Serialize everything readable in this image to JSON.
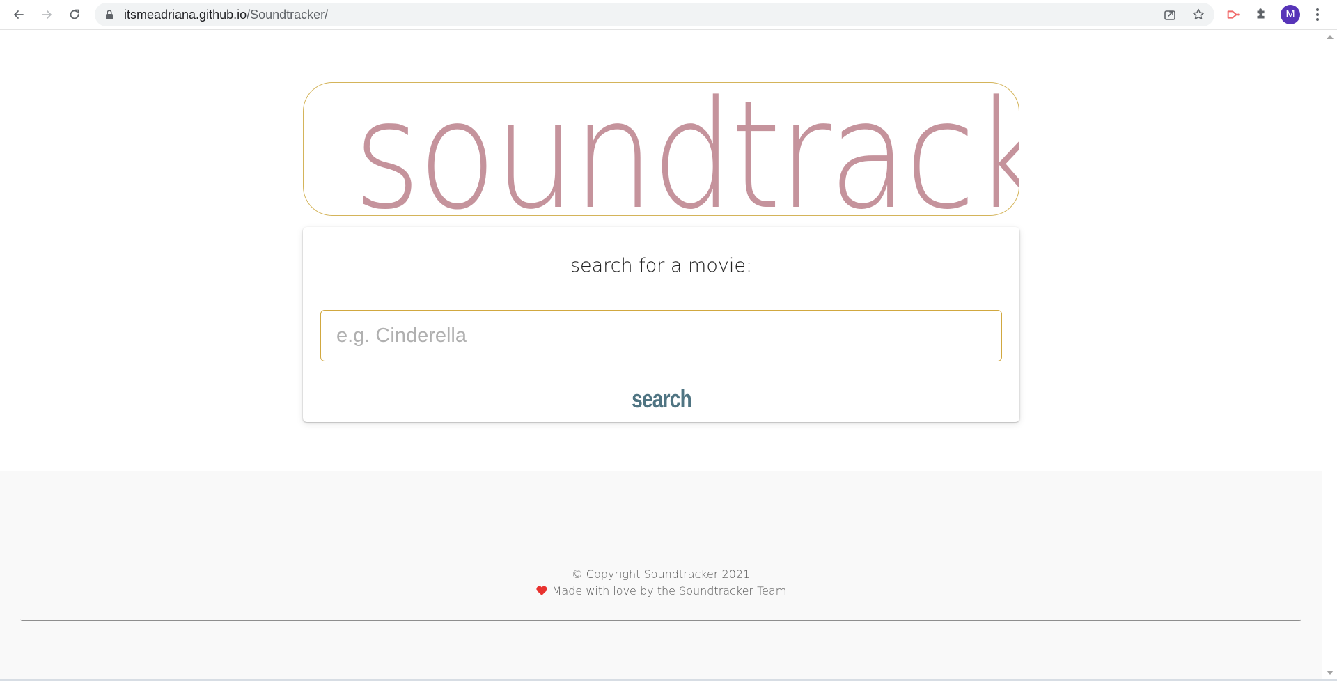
{
  "browser": {
    "url_host": "itsmeadriana.github.io",
    "url_path": "/Soundtracker/",
    "profile_initial": "M",
    "icons": [
      "back-arrow-icon",
      "forward-arrow-icon",
      "reload-icon",
      "lock-icon",
      "share-icon",
      "bookmark-star-icon",
      "extension-cast-icon",
      "puzzle-extensions-icon",
      "more-vert-icon"
    ]
  },
  "logo": {
    "text": "soundtracker"
  },
  "search": {
    "title": "search for a movie:",
    "placeholder": "e.g. Cinderella",
    "button_label": "search"
  },
  "footer": {
    "copyright": "© Copyright Soundtracker 2021",
    "made_with": "Made with love by the Soundtracker Team",
    "heart_icon": "heart-icon"
  },
  "colors": {
    "logo_text": "#c5939c",
    "accent_border": "#d4b45a",
    "search_button": "#4f7482",
    "heart": "#e8322f",
    "avatar": "#5734b8"
  }
}
